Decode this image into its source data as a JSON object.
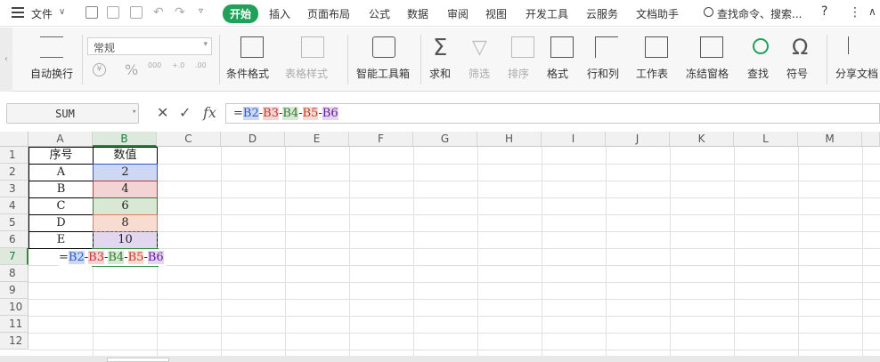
{
  "menubar": {
    "file_label": "文件",
    "tabs": [
      "开始",
      "插入",
      "页面布局",
      "公式",
      "数据",
      "审阅",
      "视图",
      "开发工具",
      "云服务",
      "文档助手"
    ],
    "active_tab": "开始",
    "search_label": "查找命令、搜索...",
    "help": "?"
  },
  "ribbon": {
    "wrap_text": "自动换行",
    "number_format": "常规",
    "percent": "%",
    "thousands": "000",
    "conditional_format": "条件格式",
    "table_style": "表格样式",
    "smart_toolbox": "智能工具箱",
    "sum": "求和",
    "filter": "筛选",
    "sort": "排序",
    "format": "格式",
    "row_col": "行和列",
    "worksheet": "工作表",
    "freeze": "冻结窗格",
    "find": "查找",
    "symbol": "符号",
    "share": "分享文档"
  },
  "formula_bar": {
    "name_box": "SUM",
    "fx": "fx",
    "parts": [
      "=",
      "B2",
      "-",
      "B3",
      "-",
      "B4",
      "-",
      "B5",
      "-",
      "B6"
    ]
  },
  "sheet": {
    "columns": [
      "A",
      "B",
      "C",
      "D",
      "E",
      "F",
      "G",
      "H",
      "I",
      "J",
      "K",
      "L",
      "M"
    ],
    "rows": [
      "1",
      "2",
      "3",
      "4",
      "5",
      "6",
      "7",
      "8",
      "9",
      "10",
      "11",
      "12"
    ],
    "header_row": [
      "序号",
      "数值"
    ],
    "data": [
      [
        "A",
        "2"
      ],
      [
        "B",
        "4"
      ],
      [
        "C",
        "6"
      ],
      [
        "D",
        "8"
      ],
      [
        "E",
        "10"
      ]
    ],
    "editing_cell": "B7",
    "editing_parts": [
      "=",
      "B2",
      "-",
      "B3",
      "-",
      "B4",
      "-",
      "B5",
      "-",
      "B6"
    ]
  }
}
